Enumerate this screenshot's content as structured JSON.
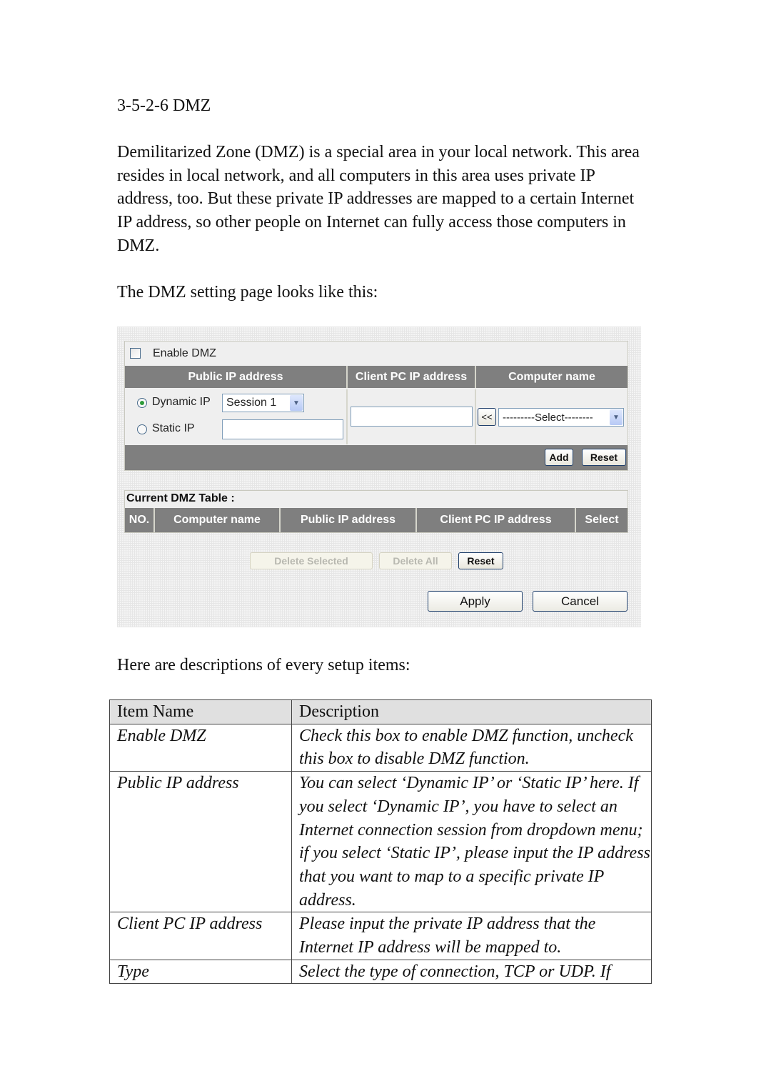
{
  "section_title": "3-5-2-6 DMZ",
  "intro_paragraph": "Demilitarized Zone (DMZ) is a special area in your local network. This area resides in local network, and all computers in this area uses private IP address, too. But these private IP addresses are mapped to a certain Internet IP address, so other people on Internet can fully access those computers in DMZ.",
  "setting_intro": "The DMZ setting page looks like this:",
  "screenshot": {
    "enable_dmz": {
      "label": "Enable DMZ",
      "checked": false
    },
    "config_headers": [
      "Public IP address",
      "Client PC IP address",
      "Computer name"
    ],
    "public_ip": {
      "dynamic_label": "Dynamic IP",
      "dynamic_selected": true,
      "session_value": "Session 1",
      "static_label": "Static IP",
      "static_value": ""
    },
    "client_pc_ip_value": "",
    "copy_button": "<<",
    "computer_select_value": "---------Select--------",
    "add_button": "Add",
    "reset_button": "Reset",
    "table_title": "Current DMZ Table :",
    "table_headers": [
      "NO.",
      "Computer name",
      "Public IP address",
      "Client PC IP address",
      "Select"
    ],
    "table_rows": [],
    "delete_selected_button": "Delete Selected",
    "delete_all_button": "Delete All",
    "table_reset_button": "Reset",
    "apply_button": "Apply",
    "cancel_button": "Cancel",
    "arrow_glyph": "▼"
  },
  "desc_intro": "Here are descriptions of every setup items:",
  "desc_table": {
    "headers": [
      "Item Name",
      "Description"
    ],
    "rows": [
      {
        "name": "Enable DMZ",
        "desc": "Check this box to enable DMZ function, uncheck this box to disable DMZ function."
      },
      {
        "name": "Public IP address",
        "desc": "You can select ‘Dynamic IP’ or ‘Static IP’ here. If you select ‘Dynamic IP’, you have to select an Internet connection session from dropdown menu; if you select ‘Static IP’, please input the IP address that you want to map to a specific private IP address."
      },
      {
        "name": "Client PC IP address",
        "desc": "Please input the private IP address that the Internet IP address will be mapped to."
      },
      {
        "name": "Type",
        "desc": "Select the type of connection, TCP or UDP. If"
      }
    ]
  }
}
